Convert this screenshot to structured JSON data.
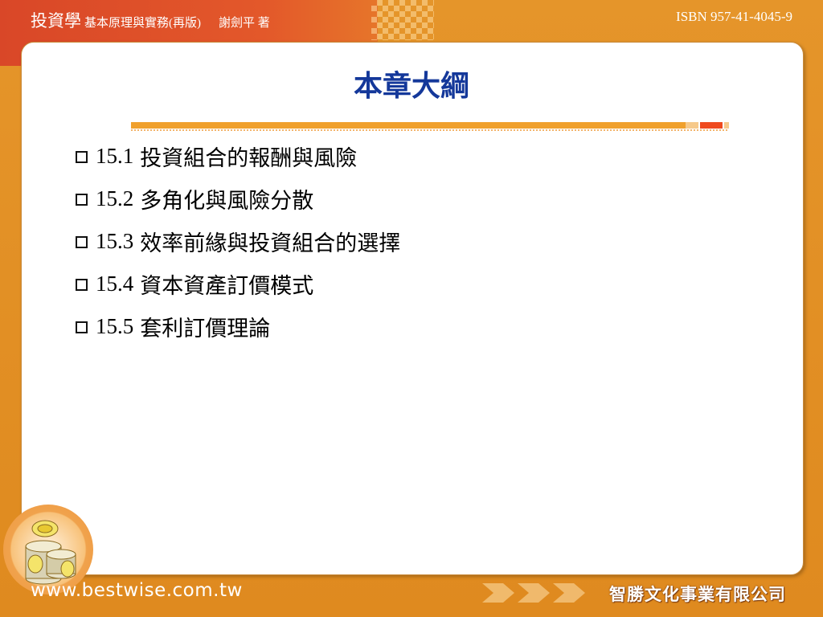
{
  "header": {
    "book_title": "投資學",
    "book_subtitle": "基本原理與實務(再版)",
    "author": "謝劍平 著",
    "isbn": "ISBN 957-41-4045-9"
  },
  "slide": {
    "title": "本章大綱",
    "items": [
      {
        "number": "15.1",
        "text": "投資組合的報酬與風險"
      },
      {
        "number": "15.2",
        "text": "多角化與風險分散"
      },
      {
        "number": "15.3",
        "text": "效率前緣與投資組合的選擇"
      },
      {
        "number": "15.4",
        "text": "資本資產訂價模式"
      },
      {
        "number": "15.5",
        "text": "套利訂價理論"
      }
    ]
  },
  "footer": {
    "url": "www.bestwise.com.tw",
    "company": "智勝文化事業有限公司"
  },
  "icons": [
    "checkbox-icon",
    "coins-icon",
    "arrow-right-icon"
  ],
  "colors": {
    "background_orange": "#e5952a",
    "header_red": "#d94728",
    "title_blue": "#14389a",
    "rule_orange": "#f0a02c",
    "rule_red": "#ef4a1e"
  }
}
